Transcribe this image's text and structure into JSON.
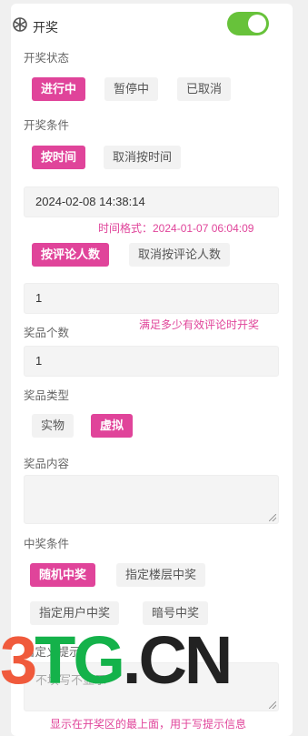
{
  "header": {
    "title": "开奖",
    "icon": "gear-icon",
    "toggle_on": true
  },
  "status": {
    "label": "开奖状态",
    "options": [
      "进行中",
      "暂停中",
      "已取消"
    ],
    "selected": "进行中"
  },
  "conditions": {
    "label": "开奖条件",
    "by_time": "按时间",
    "cancel_by_time": "取消按时间",
    "time_value": "2024-02-08 14:38:14",
    "time_hint": "时间格式：2024-01-07 06:04:09",
    "by_comments": "按评论人数",
    "cancel_by_comments": "取消按评论人数",
    "comments_value": "1",
    "comments_hint": "满足多少有效评论时开奖"
  },
  "prize_count": {
    "label": "奖品个数",
    "value": "1"
  },
  "prize_type": {
    "label": "奖品类型",
    "options": [
      "实物",
      "虚拟"
    ],
    "selected": "虚拟"
  },
  "prize_content": {
    "label": "奖品内容",
    "value": ""
  },
  "win_condition": {
    "label": "中奖条件",
    "options": [
      "随机中奖",
      "指定楼层中奖",
      "指定用户中奖",
      "暗号中奖"
    ],
    "selected": "随机中奖"
  },
  "tip": {
    "label": "自定义提示",
    "placeholder": "不填写不显示",
    "hint": "显示在开奖区的最上面，用于写提示信息"
  },
  "watermark": {
    "part1": "3",
    "part2": "TG",
    "part3": ".CN"
  },
  "colors": {
    "accent": "#e0449a",
    "toggle": "#67c23a"
  }
}
